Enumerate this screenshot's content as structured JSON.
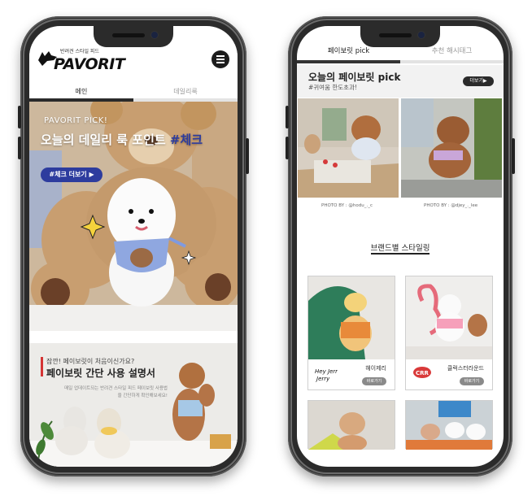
{
  "left_phone": {
    "logo": {
      "tagline": "반려견 스타일 피드",
      "wordmark": "PAVORIT"
    },
    "tabs": [
      {
        "label": "메인",
        "active": true
      },
      {
        "label": "데일리룩",
        "active": false
      }
    ],
    "hero": {
      "eyebrow": "PAVORIT PICK!",
      "title_main": "오늘의 데일리 룩 포인트 ",
      "title_highlight": "#체크",
      "cta_label": "#체크 더보기 ▶"
    },
    "guide": {
      "question": "잠깐! 페이보릿이 처음이신가요?",
      "title": "페이보릿 간단 사용 설명서",
      "description": "매일 업데이트되는 반려견 스타일 피드 페이보릿 사용법을 간단하게 확인해보세요!"
    }
  },
  "right_phone": {
    "tabs": [
      {
        "label": "페이보릿 pick",
        "active": true
      },
      {
        "label": "추천 해시태그",
        "active": false
      }
    ],
    "pick": {
      "title": "오늘의 페이보릿 pick",
      "subtitle": "#귀여움 한도초과!",
      "more_label": "더보기▶",
      "credits": [
        "PHOTO BY : @hodu_._c",
        "PHOTO BY : @djey_._lee"
      ]
    },
    "brand_section": {
      "title": "브랜드별 스타일링",
      "brands": [
        {
          "name": "헤이제리",
          "logo_text": "Hey Jerry",
          "button": "바로가기"
        },
        {
          "name": "클럭스터라운드",
          "logo_text": "CRR",
          "button": "바로가기"
        }
      ]
    }
  },
  "colors": {
    "accent_blue": "#2d3c9e",
    "accent_red": "#d43434",
    "dark": "#2b2b2b",
    "frame": "#2b2b2b"
  },
  "icons": [
    "menu-icon",
    "dog-logo-icon",
    "sparkle-icon"
  ]
}
